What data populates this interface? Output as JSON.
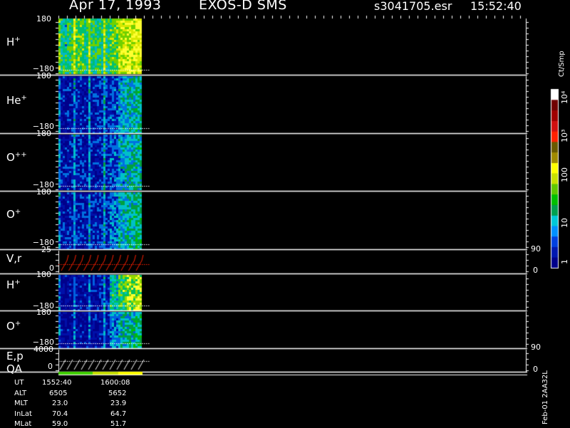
{
  "header": {
    "date": "Apr 17, 1993",
    "instrument": "EXOS-D SMS",
    "file": "s3041705.esr",
    "time": "15:52:40"
  },
  "colorbar": {
    "unit": "Ct/Smp",
    "ticks": [
      "1",
      "10",
      "100",
      "10³",
      "10⁴"
    ],
    "colors": [
      "#00008b",
      "#0018b0",
      "#0040e0",
      "#0090ff",
      "#00c8d8",
      "#00a050",
      "#00c000",
      "#60c800",
      "#c8e000",
      "#ffff00",
      "#a08a00",
      "#6a5a00",
      "#ff2000",
      "#d01010",
      "#a00000",
      "#700000",
      "#ffffff"
    ]
  },
  "panels": [
    {
      "name": "H",
      "sup": "+",
      "top": "180",
      "bottom": "−180",
      "bin_level": [
        0.45,
        0.55,
        0.6,
        0.5,
        0.52,
        0.48,
        0.6,
        0.75,
        0.8,
        0.85
      ],
      "colors": [
        "#0000a0",
        "#0030d0",
        "#00b8c8",
        "#00c070",
        "#70d000",
        "#d8e800",
        "#ffff30"
      ]
    },
    {
      "name": "He",
      "sup": "+",
      "top": "180",
      "bottom": "−180",
      "bin_level": [
        0.15,
        0.18,
        0.2,
        0.18,
        0.2,
        0.22,
        0.3,
        0.45,
        0.5,
        0.55
      ],
      "colors": [
        "#00008b",
        "#0010a8",
        "#0070e0",
        "#00c0c8",
        "#00a040",
        "#00c000",
        "#40b800"
      ]
    },
    {
      "name": "O",
      "sup": "++",
      "top": "180",
      "bottom": "−180",
      "bin_level": [
        0.15,
        0.18,
        0.2,
        0.18,
        0.2,
        0.22,
        0.3,
        0.45,
        0.5,
        0.55
      ],
      "colors": [
        "#00008b",
        "#0010a8",
        "#0070e0",
        "#00c0c8",
        "#00a040",
        "#00c000",
        "#40b800"
      ]
    },
    {
      "name": "O",
      "sup": "+",
      "top": "180",
      "bottom": "−180",
      "bin_level": [
        0.15,
        0.18,
        0.2,
        0.18,
        0.22,
        0.25,
        0.35,
        0.5,
        0.55,
        0.6
      ],
      "colors": [
        "#00008b",
        "#0010a8",
        "#0070e0",
        "#00c0c8",
        "#00a040",
        "#00c000",
        "#40b800"
      ]
    }
  ],
  "vr_panel": {
    "label": "V,r",
    "top": "25",
    "bottom": "0",
    "right_top": "90",
    "right_bottom": "0"
  },
  "panels2": [
    {
      "name": "H",
      "sup": "+",
      "top": "180",
      "bottom": "−180",
      "bin_level": [
        0.12,
        0.15,
        0.15,
        0.15,
        0.18,
        0.2,
        0.55,
        0.7,
        0.8,
        0.85
      ],
      "colors": [
        "#00008b",
        "#0010a8",
        "#0060e0",
        "#00c0c8",
        "#00c060",
        "#90d800",
        "#ffff30"
      ]
    },
    {
      "name": "O",
      "sup": "+",
      "top": "180",
      "bottom": "−180",
      "bin_level": [
        0.12,
        0.14,
        0.14,
        0.15,
        0.16,
        0.18,
        0.4,
        0.5,
        0.55,
        0.6
      ],
      "colors": [
        "#00008b",
        "#0010a8",
        "#0060e0",
        "#00c0c8",
        "#00a040",
        "#00c000",
        "#40b800"
      ]
    }
  ],
  "ep_panel": {
    "label1": "E,p",
    "label2": "QA",
    "top": "4000",
    "bottom": "0",
    "right_top": "90",
    "right_bottom": "0"
  },
  "ephemeris": {
    "labels": [
      "UT",
      "ALT",
      "MLT",
      "InLat",
      "MLat"
    ],
    "col1": [
      "1552:40",
      "6505",
      "23.0",
      "70.4",
      "59.0"
    ],
    "col2": [
      "1600:08",
      "5652",
      "23.9",
      "64.7",
      "51.7"
    ]
  },
  "footer_vertical": "Feb-01 2AA32L"
}
